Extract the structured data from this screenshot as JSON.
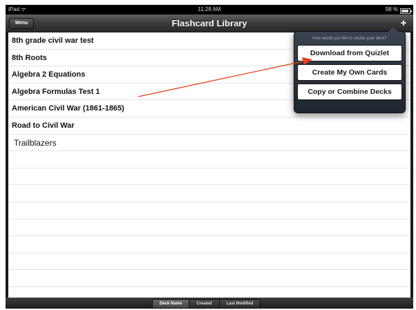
{
  "status_bar": {
    "carrier": "iPad ᯤ",
    "time": "11:28 AM",
    "battery": "98 %"
  },
  "nav_bar": {
    "menu_label": "Menu",
    "title": "Flashcard Library",
    "add_label": "+"
  },
  "decks": [
    {
      "name": "8th grade civil war test"
    },
    {
      "name": "8th Roots"
    },
    {
      "name": "Algebra 2 Equations"
    },
    {
      "name": "Algebra Formulas Test 1"
    },
    {
      "name": "American Civil War (1861-1865)"
    },
    {
      "name": "Road to Civil War"
    },
    {
      "name": "Trailblazers"
    }
  ],
  "popover": {
    "prompt": "How would you like to create your deck?",
    "options": [
      {
        "label": "Download from Quizlet"
      },
      {
        "label": "Create My Own Cards"
      },
      {
        "label": "Copy or Combine Decks"
      }
    ]
  },
  "sort_bar": {
    "options": [
      {
        "label": "Deck Name"
      },
      {
        "label": "Created"
      },
      {
        "label": "Last Modified"
      }
    ],
    "selected": "Deck Name"
  },
  "colors": {
    "annotation_arrow": "#e8401c",
    "bar_dark": "#2a2a2a",
    "popover_bg": "#2b323d"
  }
}
